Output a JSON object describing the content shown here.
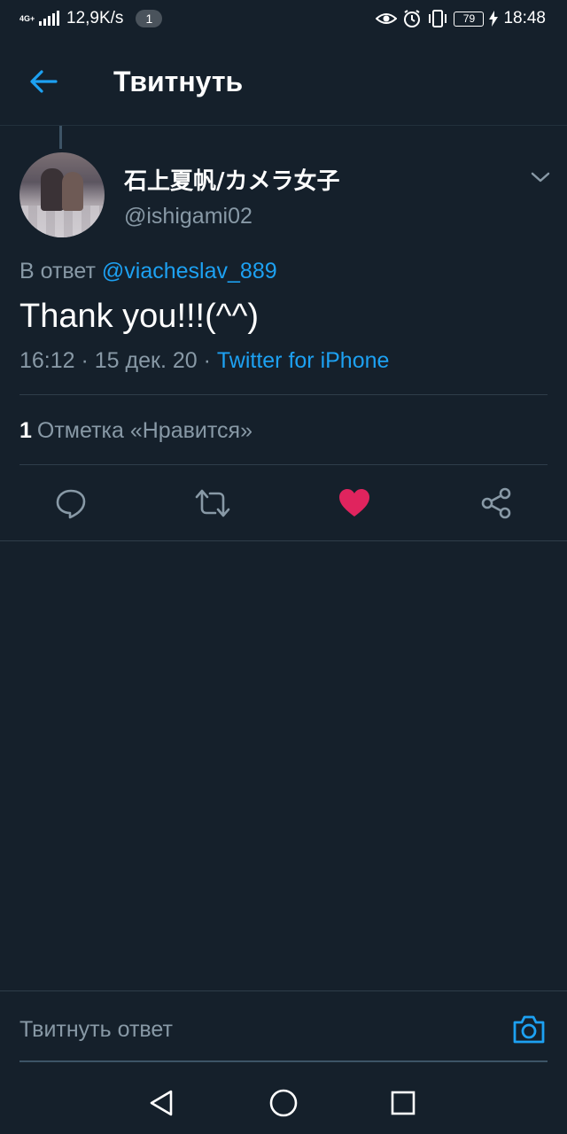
{
  "status_bar": {
    "network_type": "4G+",
    "speed": "12,9K/s",
    "notification_count": "1",
    "battery": "79",
    "time": "18:48"
  },
  "header": {
    "title": "Твитнуть"
  },
  "tweet": {
    "display_name": "石上夏帆/カメラ女子",
    "handle": "@ishigami02",
    "reply_prefix": "В ответ",
    "reply_mention": "@viacheslav_889",
    "text": "Thank you!!!(^^)",
    "timestamp": "16:12 · 15 дек. 20 · ",
    "source": "Twitter for iPhone",
    "like_count": "1",
    "like_label": "Отметка «Нравится»",
    "liked": true,
    "like_color": "#e0245e",
    "link_color": "#1da1f2"
  },
  "actions": {
    "reply_icon": "reply-icon",
    "retweet_icon": "retweet-icon",
    "like_icon": "heart-icon",
    "share_icon": "share-icon"
  },
  "composer": {
    "placeholder": "Твитнуть ответ"
  },
  "colors": {
    "background": "#15202b",
    "secondary_text": "#8899a6",
    "divider": "#2f3d4a"
  }
}
